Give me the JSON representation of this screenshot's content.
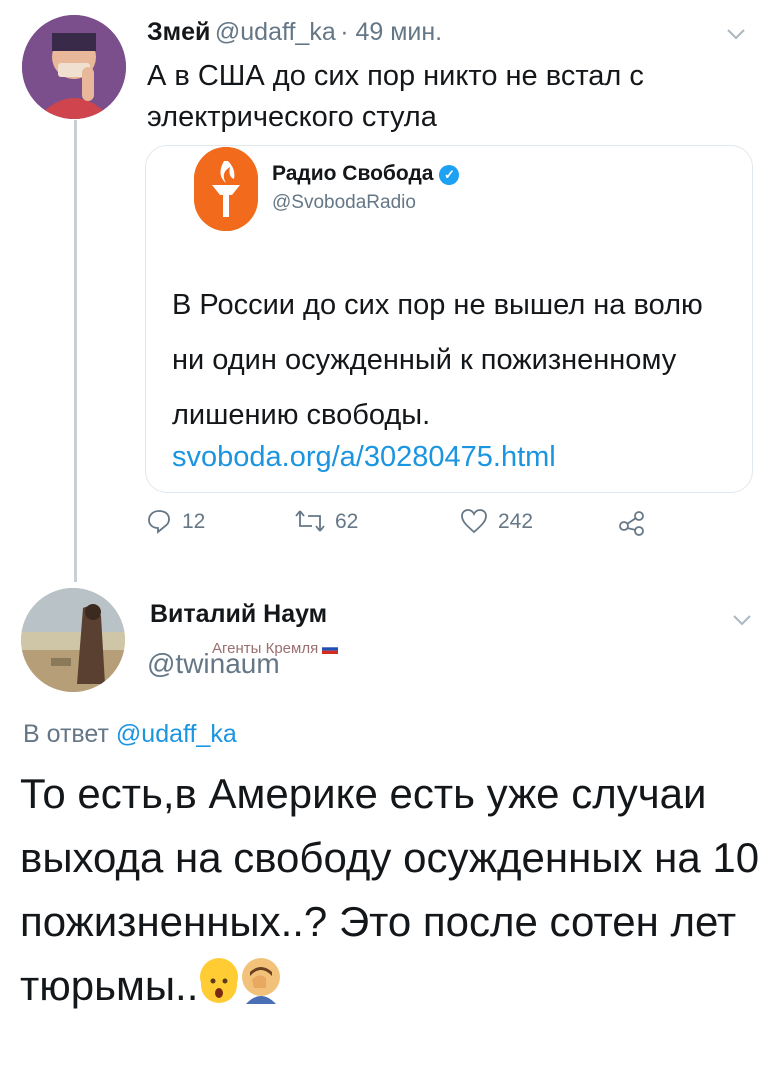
{
  "tweet1": {
    "name": "Змей",
    "handle": "@udaff_ka",
    "time": "· 49 мин.",
    "text": "А в США до сих пор никто не встал с электрического стула",
    "avatar_icon": "user-avatar-icon"
  },
  "quote": {
    "name": "Радио Свобода",
    "handle": "@SvobodaRadio",
    "text": "В России до сих пор не вышел на волю ни один осужденный к пожизненному лишению свободы.",
    "link": "svoboda.org/a/30280475.html",
    "logo_icon": "torch-logo-icon",
    "verified_icon": "verified-badge-icon"
  },
  "actions": {
    "replies": "12",
    "retweets": "62",
    "likes": "242"
  },
  "tweet2": {
    "name": "Виталий Наум",
    "badge": "Агенты Кремля",
    "handle": "@twinaum",
    "reply_prefix": "В ответ",
    "reply_mention": "@udaff_ka",
    "text": "То есть,в Америке есть уже случаи выхода на свободу осужденных на 10 пожизненных..? Это после сотен лет тюрьмы.."
  },
  "colors": {
    "link": "#1b95e0",
    "muted": "#657786",
    "brand_orange": "#f26a1b"
  }
}
